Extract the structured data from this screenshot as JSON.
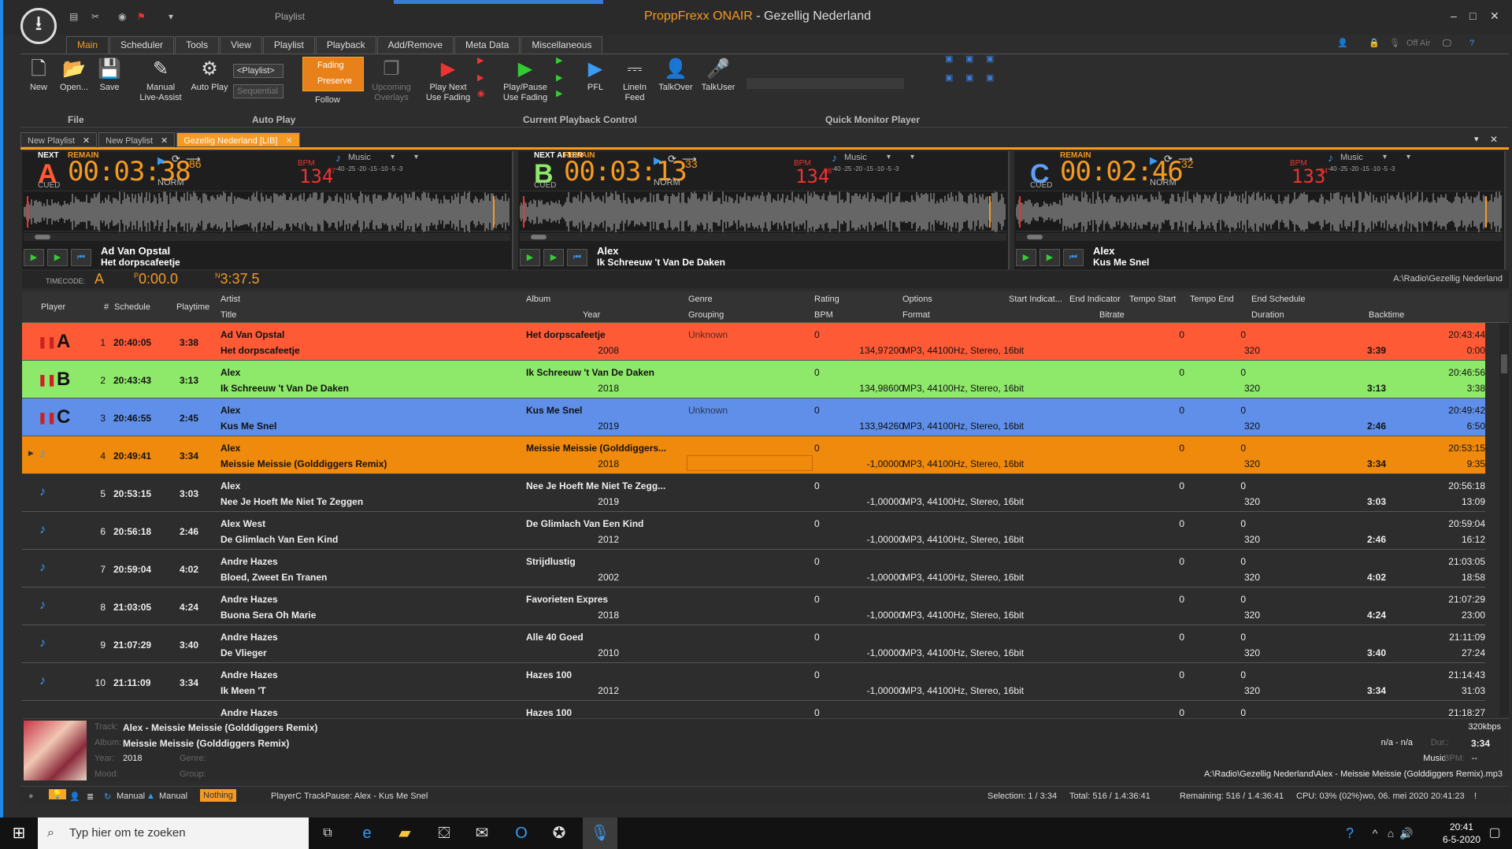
{
  "window": {
    "breadcrumb": "Playlist",
    "brand": "ProppFrexx ONAIR",
    "title_sep": " - ",
    "title": "Gezellig Nederland",
    "minimize": "–",
    "maximize": "□",
    "close": "✕"
  },
  "ribbon_tabs": [
    "Main",
    "Scheduler",
    "Tools",
    "View",
    "Playlist",
    "Playback",
    "Add/Remove",
    "Meta Data",
    "Miscellaneous"
  ],
  "ribbon": {
    "new": "New",
    "open": "Open...",
    "save": "Save",
    "manual": "Manual",
    "live_assist": "Live-Assist",
    "auto_play": "Auto Play",
    "playlist_select": "<Playlist>",
    "sequential_select": "Sequential",
    "fading": "Fading",
    "preserve": "Preserve",
    "follow": "Follow",
    "upcoming": "Upcoming",
    "overlays": "Overlays",
    "play_next": "Play Next",
    "use_fading": "Use Fading",
    "play_pause": "Play/Pause",
    "use_fading2": "Use Fading",
    "pfl": "PFL",
    "linein": "LineIn",
    "feed": "Feed",
    "talkover": "TalkOver",
    "talkuser": "TalkUser",
    "group_file": "File",
    "group_auto": "Auto Play",
    "group_playback": "Current Playback Control",
    "group_monitor": "Quick Monitor Player",
    "off_air": "Off Air"
  },
  "doc_tabs": [
    {
      "label": "New Playlist"
    },
    {
      "label": "New Playlist"
    },
    {
      "label": "Gezellig Nederland [LIB]"
    }
  ],
  "decks": [
    {
      "letter": "A",
      "tag": "NEXT",
      "remain_label": "REMAIN",
      "time": "00:03:38",
      "time_frac": "86",
      "norm": "NORM",
      "bpm_label": "BPM",
      "bpm": "134",
      "bpm_frac": "97",
      "music": "Music",
      "meter": "-40 -25 -20 -15  -10   -5  -3",
      "cued": "CUED",
      "artist": "Ad Van Opstal",
      "title": "Het dorpscafeetje",
      "color": "#ff5a36"
    },
    {
      "letter": "B",
      "tag": "NEXT AFTER",
      "remain_label": "REMAIN",
      "time": "00:03:13",
      "time_frac": "33",
      "norm": "NORM",
      "bpm_label": "BPM",
      "bpm": "134",
      "bpm_frac": "98",
      "music": "Music",
      "meter": "-40 -25 -20 -15  -10   -5  -3",
      "cued": "CUED",
      "artist": "Alex",
      "title": "Ik Schreeuw 't Van De Daken",
      "color": "#8ee86a"
    },
    {
      "letter": "C",
      "tag": "",
      "remain_label": "REMAIN",
      "time": "00:02:46",
      "time_frac": "32",
      "norm": "NORM",
      "bpm_label": "BPM",
      "bpm": "133",
      "bpm_frac": "94",
      "music": "Music",
      "meter": "-40 -25 -20 -15  -10   -5  -3",
      "cued": "CUED",
      "artist": "Alex",
      "title": "Kus Me Snel",
      "color": "#5ea0f5"
    }
  ],
  "timecode": {
    "label": "TIMECODE:",
    "player": "A",
    "p_prefix": "P",
    "position": "0:00.0",
    "n_prefix": "N",
    "next": "3:37.5",
    "path": "A:\\Radio\\Gezellig Nederland"
  },
  "grid_headers": {
    "player": "Player",
    "num": "#",
    "schedule": "Schedule",
    "playtime": "Playtime",
    "artist": "Artist",
    "title": "Title",
    "album": "Album",
    "year": "Year",
    "genre": "Genre",
    "grouping": "Grouping",
    "rating": "Rating",
    "bpm": "BPM",
    "options": "Options",
    "format": "Format",
    "start_ind": "Start Indicat...",
    "end_ind": "End Indicator",
    "bitrate": "Bitrate",
    "tempo_start": "Tempo Start",
    "tempo_end": "Tempo End",
    "end_schedule": "End Schedule",
    "duration": "Duration",
    "backtime": "Backtime"
  },
  "rows": [
    {
      "player": "A",
      "num": "1",
      "schedule": "20:40:05",
      "playtime": "3:38",
      "artist": "Ad Van Opstal",
      "title": "Het dorpscafeetje",
      "album": "Het dorpscafeetje",
      "year": "2008",
      "genre": "Unknown",
      "rating": "0",
      "bpm": "134,97200",
      "format": "MP3, 44100Hz, Stereo, 16bit",
      "tempo_start": "0",
      "tempo_end": "0",
      "bitrate": "320",
      "duration": "3:39",
      "end_schedule": "20:43:44",
      "backtime": "0:00",
      "bg": "#ff5a36",
      "fg": "#111"
    },
    {
      "player": "B",
      "num": "2",
      "schedule": "20:43:43",
      "playtime": "3:13",
      "artist": "Alex",
      "title": "Ik Schreeuw 't Van De Daken",
      "album": "Ik Schreeuw 't Van De Daken",
      "year": "2018",
      "genre": "",
      "rating": "0",
      "bpm": "134,98600",
      "format": "MP3, 44100Hz, Stereo, 16bit",
      "tempo_start": "0",
      "tempo_end": "0",
      "bitrate": "320",
      "duration": "3:13",
      "end_schedule": "20:46:56",
      "backtime": "3:38",
      "bg": "#8ee86a",
      "fg": "#111"
    },
    {
      "player": "C",
      "num": "3",
      "schedule": "20:46:55",
      "playtime": "2:45",
      "artist": "Alex",
      "title": "Kus Me Snel",
      "album": "Kus Me Snel",
      "year": "2019",
      "genre": "Unknown",
      "rating": "0",
      "bpm": "133,94260",
      "format": "MP3, 44100Hz, Stereo, 16bit",
      "tempo_start": "0",
      "tempo_end": "0",
      "bitrate": "320",
      "duration": "2:46",
      "end_schedule": "20:49:42",
      "backtime": "6:50",
      "bg": "#5f8fe8",
      "fg": "#111"
    },
    {
      "player": "♪",
      "num": "4",
      "schedule": "20:49:41",
      "playtime": "3:34",
      "artist": "Alex",
      "title": "Meissie Meissie (Golddiggers Remix)",
      "album": "Meissie Meissie (Golddiggers...",
      "year": "2018",
      "genre": "",
      "rating": "0",
      "bpm": "-1,00000",
      "format": "MP3, 44100Hz, Stereo, 16bit",
      "tempo_start": "0",
      "tempo_end": "0",
      "bitrate": "320",
      "duration": "3:34",
      "end_schedule": "20:53:15",
      "backtime": "9:35",
      "bg": "#f08a0c",
      "fg": "#111"
    },
    {
      "player": "♪",
      "num": "5",
      "schedule": "20:53:15",
      "playtime": "3:03",
      "artist": "Alex",
      "title": "Nee Je Hoeft Me Niet Te Zeggen",
      "album": "Nee Je Hoeft Me Niet Te Zegg...",
      "year": "2019",
      "genre": "",
      "rating": "0",
      "bpm": "-1,00000",
      "format": "MP3, 44100Hz, Stereo, 16bit",
      "tempo_start": "0",
      "tempo_end": "0",
      "bitrate": "320",
      "duration": "3:03",
      "end_schedule": "20:56:18",
      "backtime": "13:09",
      "bg": "#2d2d2d",
      "fg": "#eee"
    },
    {
      "player": "♪",
      "num": "6",
      "schedule": "20:56:18",
      "playtime": "2:46",
      "artist": "Alex West",
      "title": "De Glimlach Van Een Kind",
      "album": "De Glimlach Van Een Kind",
      "year": "2012",
      "genre": "",
      "rating": "0",
      "bpm": "-1,00000",
      "format": "MP3, 44100Hz, Stereo, 16bit",
      "tempo_start": "0",
      "tempo_end": "0",
      "bitrate": "320",
      "duration": "2:46",
      "end_schedule": "20:59:04",
      "backtime": "16:12",
      "bg": "#2d2d2d",
      "fg": "#eee"
    },
    {
      "player": "♪",
      "num": "7",
      "schedule": "20:59:04",
      "playtime": "4:02",
      "artist": "Andre Hazes",
      "title": "Bloed, Zweet En Tranen",
      "album": "Strijdlustig",
      "year": "2002",
      "genre": "",
      "rating": "0",
      "bpm": "-1,00000",
      "format": "MP3, 44100Hz, Stereo, 16bit",
      "tempo_start": "0",
      "tempo_end": "0",
      "bitrate": "320",
      "duration": "4:02",
      "end_schedule": "21:03:05",
      "backtime": "18:58",
      "bg": "#2d2d2d",
      "fg": "#eee"
    },
    {
      "player": "♪",
      "num": "8",
      "schedule": "21:03:05",
      "playtime": "4:24",
      "artist": "Andre Hazes",
      "title": "Buona Sera   Oh Marie",
      "album": "Favorieten Expres",
      "year": "2018",
      "genre": "",
      "rating": "0",
      "bpm": "-1,00000",
      "format": "MP3, 44100Hz, Stereo, 16bit",
      "tempo_start": "0",
      "tempo_end": "0",
      "bitrate": "320",
      "duration": "4:24",
      "end_schedule": "21:07:29",
      "backtime": "23:00",
      "bg": "#2d2d2d",
      "fg": "#eee"
    },
    {
      "player": "♪",
      "num": "9",
      "schedule": "21:07:29",
      "playtime": "3:40",
      "artist": "Andre Hazes",
      "title": "De Vlieger",
      "album": "Alle 40 Goed",
      "year": "2010",
      "genre": "",
      "rating": "0",
      "bpm": "-1,00000",
      "format": "MP3, 44100Hz, Stereo, 16bit",
      "tempo_start": "0",
      "tempo_end": "0",
      "bitrate": "320",
      "duration": "3:40",
      "end_schedule": "21:11:09",
      "backtime": "27:24",
      "bg": "#2d2d2d",
      "fg": "#eee"
    },
    {
      "player": "♪",
      "num": "10",
      "schedule": "21:11:09",
      "playtime": "3:34",
      "artist": "Andre Hazes",
      "title": "Ik Meen 'T",
      "album": "Hazes 100",
      "year": "2012",
      "genre": "",
      "rating": "0",
      "bpm": "-1,00000",
      "format": "MP3, 44100Hz, Stereo, 16bit",
      "tempo_start": "0",
      "tempo_end": "0",
      "bitrate": "320",
      "duration": "3:34",
      "end_schedule": "21:14:43",
      "backtime": "31:03",
      "bg": "#2d2d2d",
      "fg": "#eee"
    },
    {
      "player": "",
      "num": "",
      "schedule": "",
      "playtime": "",
      "artist": "Andre Hazes",
      "title": "",
      "album": "Hazes 100",
      "year": "",
      "genre": "",
      "rating": "0",
      "bpm": "",
      "format": "",
      "tempo_start": "0",
      "tempo_end": "0",
      "bitrate": "",
      "duration": "",
      "end_schedule": "21:18:27",
      "backtime": "",
      "bg": "#2d2d2d",
      "fg": "#eee"
    }
  ],
  "info": {
    "track_label": "Track:",
    "track": "Alex - Meissie Meissie (Golddiggers Remix)",
    "album_label": "Album:",
    "album": "Meissie Meissie (Golddiggers Remix)",
    "year_label": "Year:",
    "year": "2018",
    "genre_label": "Genre:",
    "mood_label": "Mood:",
    "group_label": "Group:",
    "bitrate": "320kbps",
    "na": "n/a - n/a",
    "dur_label": "Dur.:",
    "dur": "3:34",
    "music": "Music",
    "bpm_label": "BPM:",
    "bpm_value": "--",
    "path": "A:\\Radio\\Gezellig Nederland\\Alex - Meissie Meissie (Golddiggers Remix).mp3"
  },
  "status": {
    "manual1": "Manual",
    "manual2": "Manual",
    "nothing": "Nothing",
    "pause": "PlayerC TrackPause: Alex - Kus Me Snel",
    "selection": "Selection: 1 / 3:34",
    "total": "Total: 516 / 1.4:36:41",
    "remaining": "Remaining: 516 / 1.4:36:41",
    "cpu": "CPU: 03% (02%)",
    "datetime": "wo, 06. mei 2020 20:41:23",
    "alert": "!"
  },
  "taskbar": {
    "search_placeholder": "Typ hier om te zoeken",
    "time": "20:41",
    "date": "6-5-2020"
  }
}
